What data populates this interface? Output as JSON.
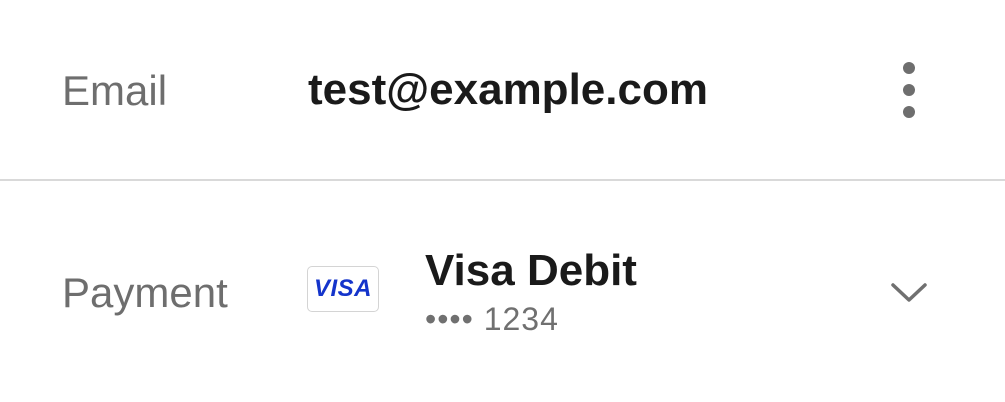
{
  "email_row": {
    "label": "Email",
    "value": "test@example.com",
    "menu_icon": "more-vertical-icon"
  },
  "payment_row": {
    "label": "Payment",
    "card_brand_logo": "VISA",
    "card_name": "Visa Debit",
    "card_number_masked": "•••• 1234",
    "expand_icon": "chevron-down-icon"
  },
  "colors": {
    "label": "#6e6e6e",
    "value": "#1a1a1a",
    "divider": "#d9d9d9",
    "visa_blue": "#1434cb"
  }
}
